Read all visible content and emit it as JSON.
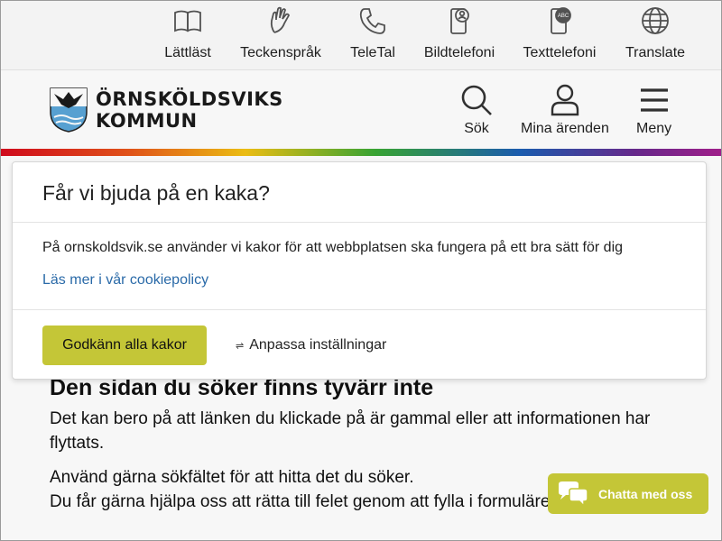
{
  "topbar": {
    "items": [
      {
        "label": "Lättläst",
        "icon": "book-icon"
      },
      {
        "label": "Teckenspråk",
        "icon": "sign-language-icon"
      },
      {
        "label": "TeleTal",
        "icon": "phone-icon"
      },
      {
        "label": "Bildtelefoni",
        "icon": "video-phone-icon"
      },
      {
        "label": "Texttelefoni",
        "icon": "text-phone-icon"
      },
      {
        "label": "Translate",
        "icon": "globe-icon"
      }
    ]
  },
  "header": {
    "logo": {
      "line1": "ÖRNSKÖLDSVIKS",
      "line2": "KOMMUN",
      "icon": "coat-of-arms-icon"
    },
    "search_label": "Sök",
    "account_label": "Mina ärenden",
    "menu_label": "Meny"
  },
  "page": {
    "heading": "Den sidan du söker finns tyvärr inte",
    "para1": "Det kan bero på att länken du klickade på är gammal eller att informationen har flyttats.",
    "para2_line1": "Använd gärna sökfältet för att hitta det du söker.",
    "para2_line2": "Du får gärna hjälpa oss att rätta till felet genom att fylla i formuläret"
  },
  "cookie": {
    "title": "Får vi bjuda på en kaka?",
    "text": "På ornskoldsvik.se använder vi kakor för att webbplatsen ska fungera på ett bra sätt för dig",
    "policy_link": "Läs mer i vår cookiepolicy",
    "accept_label": "Godkänn alla kakor",
    "customize_label": "Anpassa inställningar",
    "customize_icon": "sliders-icon"
  },
  "chat": {
    "label": "Chatta med oss",
    "icon": "chat-bubbles-icon"
  },
  "colors": {
    "accent": "#c4c637",
    "link": "#2a6aa8"
  }
}
